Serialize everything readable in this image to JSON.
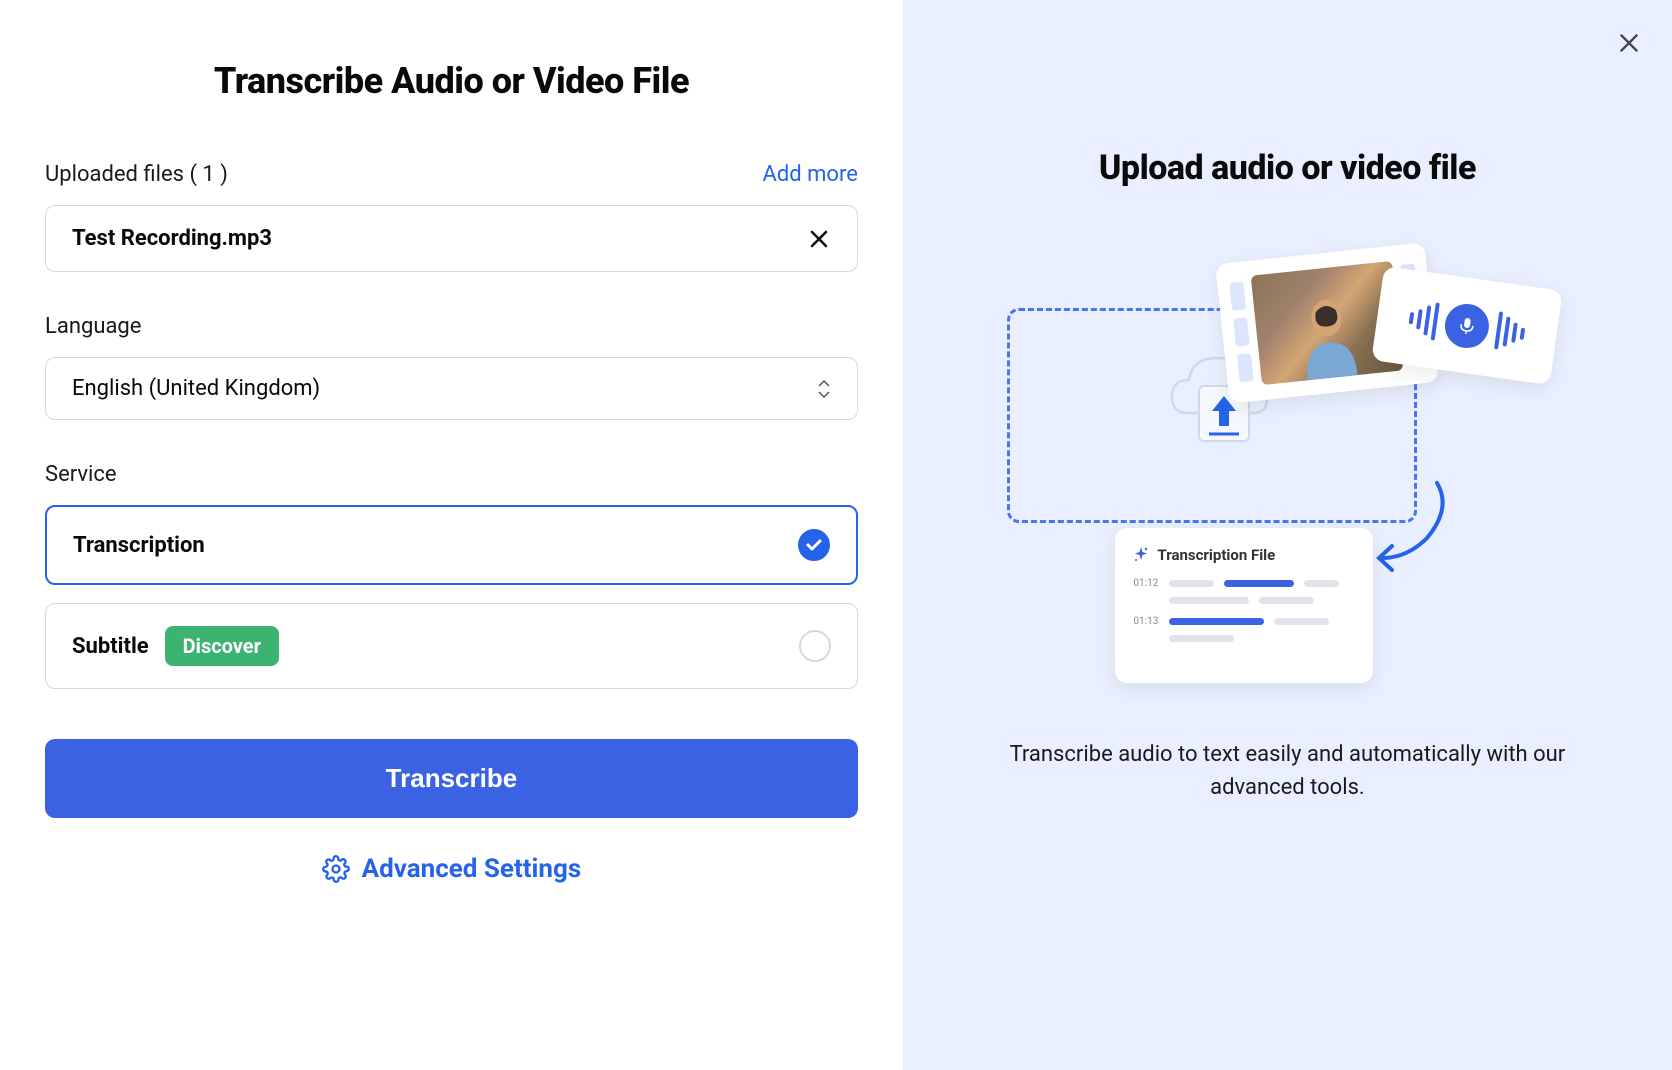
{
  "left": {
    "title": "Transcribe Audio or Video File",
    "uploaded_label": "Uploaded files ( 1 )",
    "add_more": "Add more",
    "file_name": "Test Recording.mp3",
    "language_label": "Language",
    "language_value": "English (United Kingdom)",
    "service_label": "Service",
    "service_transcription": "Transcription",
    "service_subtitle": "Subtitle",
    "discover_badge": "Discover",
    "transcribe_button": "Transcribe",
    "advanced_settings": "Advanced Settings"
  },
  "right": {
    "title": "Upload audio or video file",
    "transcription_file_label": "Transcription File",
    "time1": "01:12",
    "time2": "01:13",
    "description": "Transcribe audio to text easily and automatically with our advanced tools."
  }
}
